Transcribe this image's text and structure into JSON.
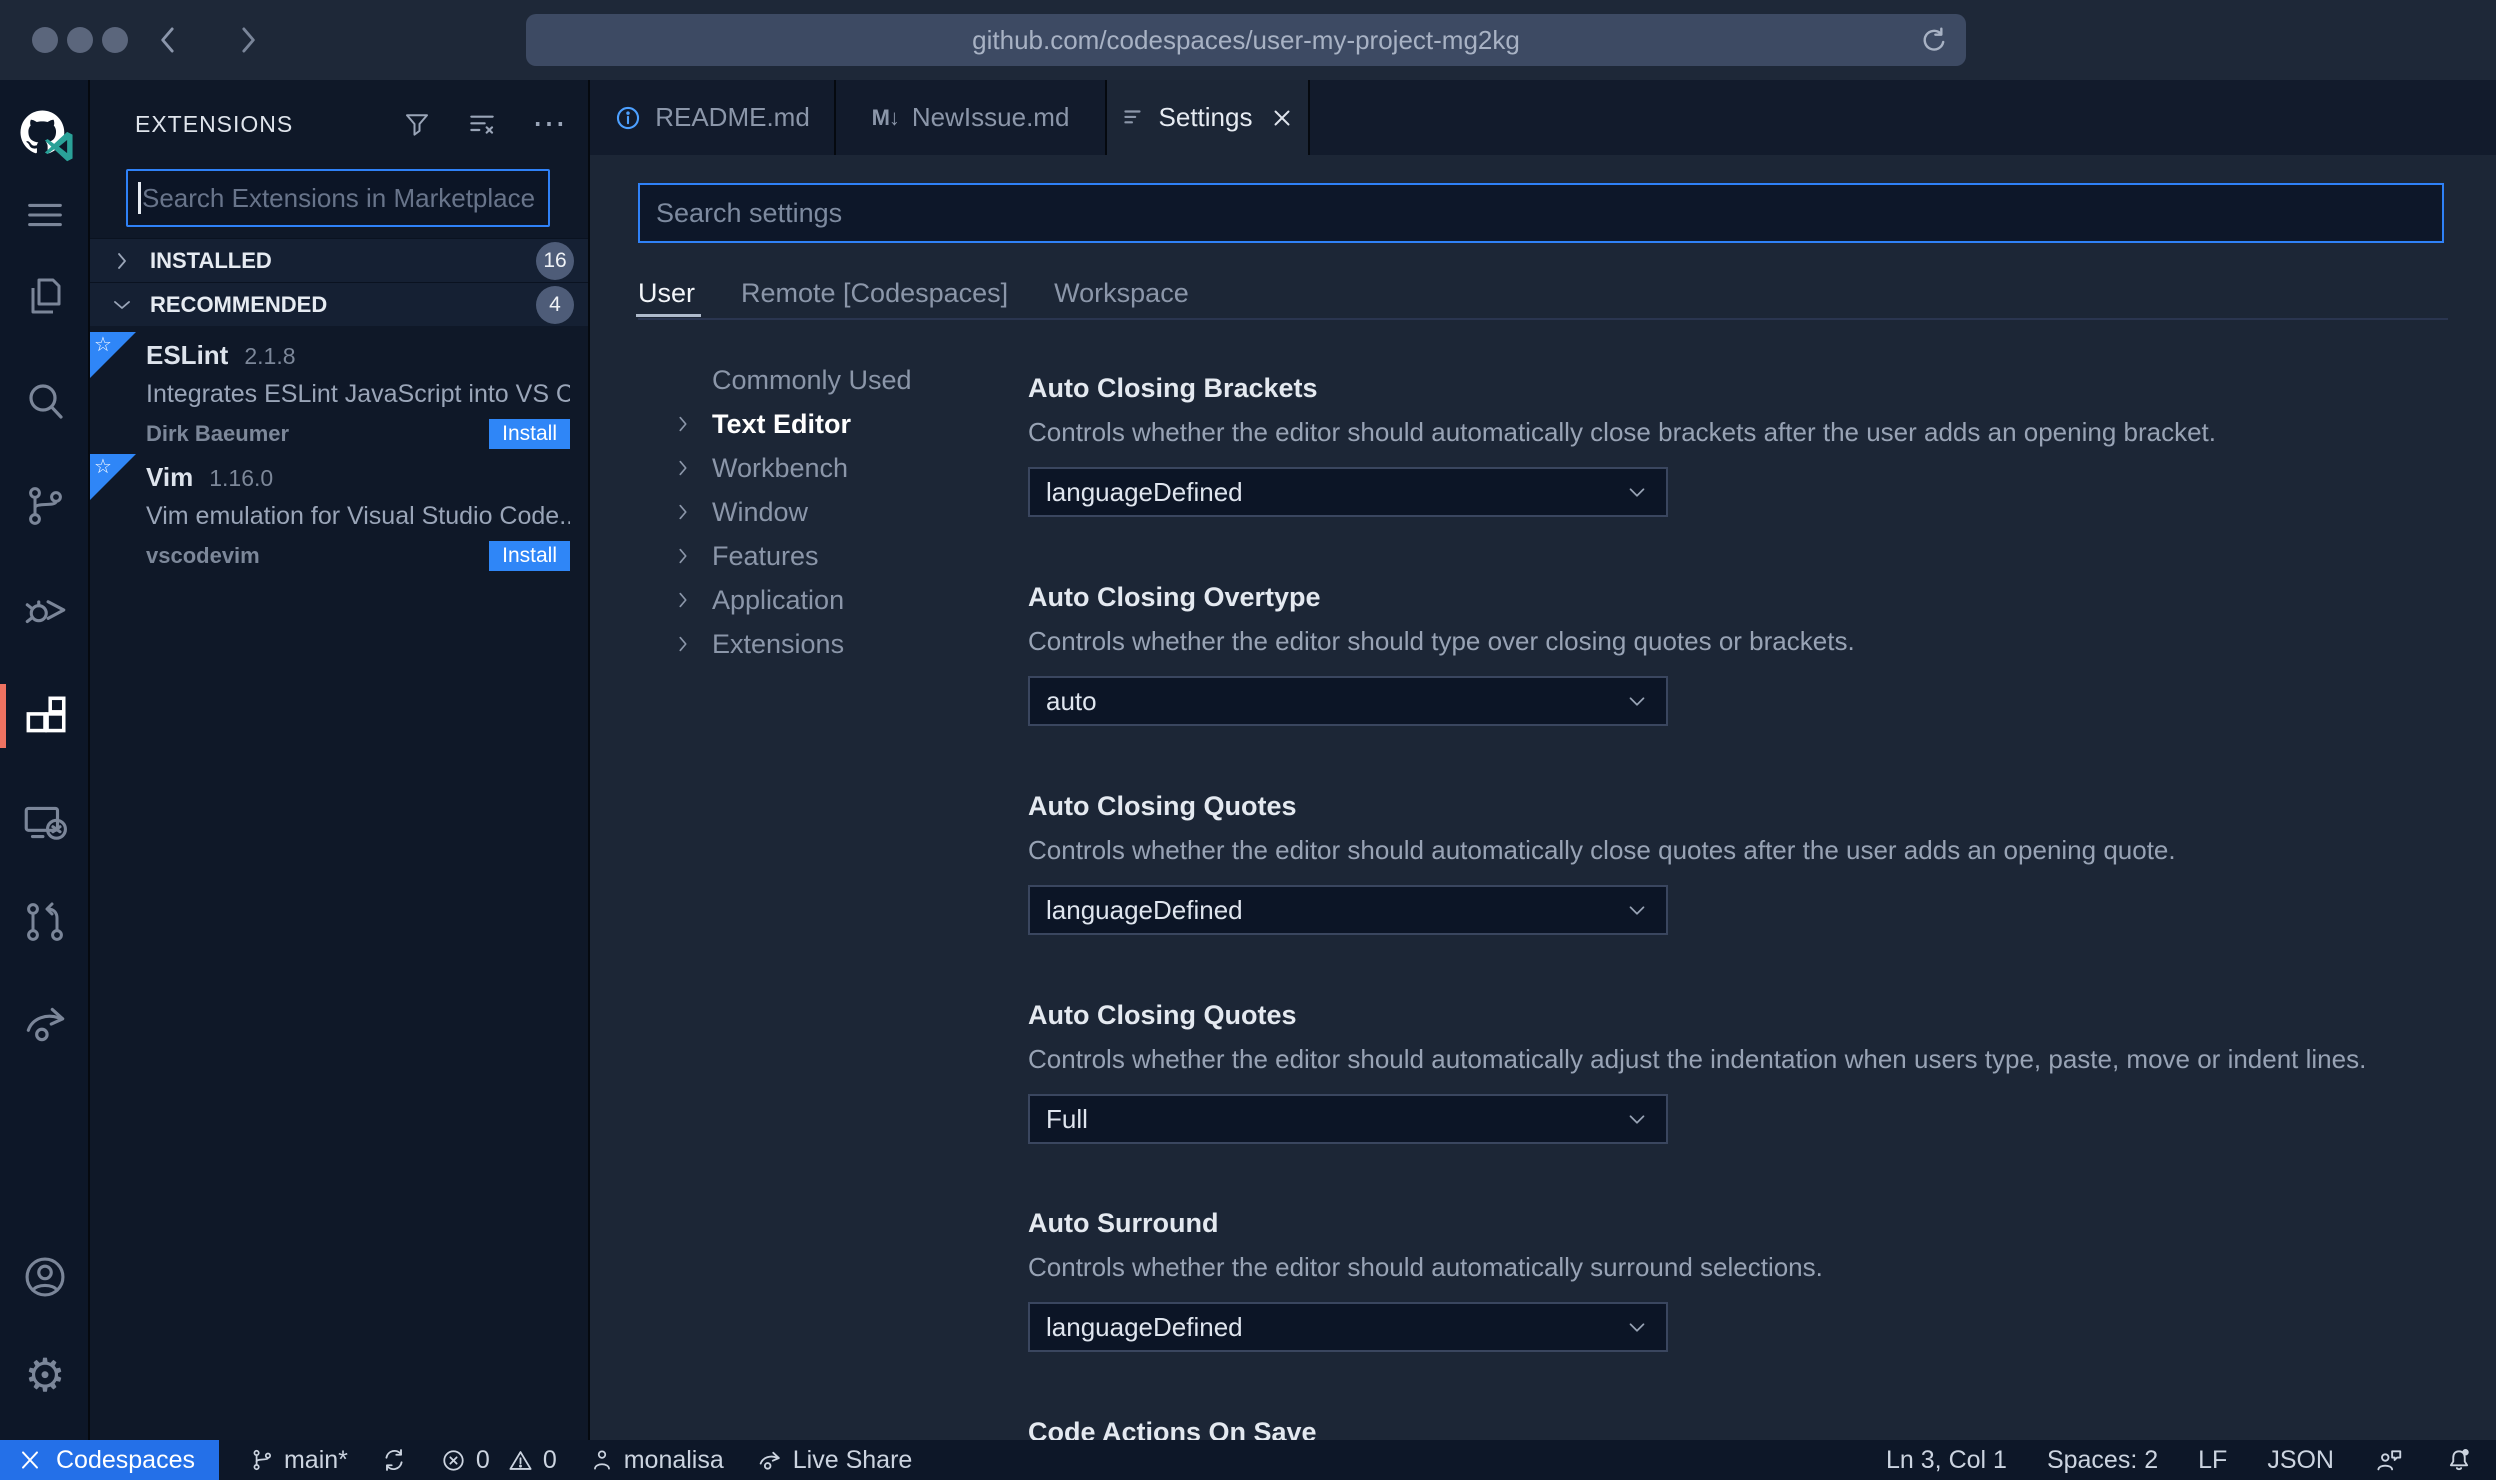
{
  "browser": {
    "url": "github.com/codespaces/user-my-project-mg2kg"
  },
  "sidebar": {
    "title": "EXTENSIONS",
    "search_placeholder": "Search Extensions in Marketplace",
    "sections": [
      {
        "label": "INSTALLED",
        "count": "16"
      },
      {
        "label": "RECOMMENDED",
        "count": "4"
      }
    ],
    "extensions": [
      {
        "name": "ESLint",
        "version": "2.1.8",
        "description": "Integrates ESLint JavaScript into VS C...",
        "publisher": "Dirk Baeumer",
        "action": "Install"
      },
      {
        "name": "Vim",
        "version": "1.16.0",
        "description": "Vim emulation for Visual Studio Code...",
        "publisher": "vscodevim",
        "action": "Install"
      }
    ]
  },
  "tabs": [
    {
      "label": "README.md"
    },
    {
      "label": "NewIssue.md"
    },
    {
      "label": "Settings"
    }
  ],
  "settings": {
    "search_placeholder": "Search settings",
    "scopes": [
      "User",
      "Remote [Codespaces]",
      "Workspace"
    ],
    "tree": [
      "Commonly Used",
      "Text Editor",
      "Workbench",
      "Window",
      "Features",
      "Application",
      "Extensions"
    ],
    "entries": [
      {
        "title": "Auto Closing Brackets",
        "description": "Controls whether the editor should automatically close brackets after the user adds an opening bracket.",
        "value": "languageDefined"
      },
      {
        "title": "Auto Closing Overtype",
        "description": "Controls whether the editor should type over closing quotes or brackets.",
        "value": "auto"
      },
      {
        "title": "Auto Closing Quotes",
        "description": "Controls whether the editor should automatically close quotes after the user adds an opening quote.",
        "value": "languageDefined"
      },
      {
        "title": "Auto Closing Quotes",
        "description": "Controls whether the editor should automatically adjust the indentation when users type, paste, move or indent lines.",
        "value": "Full"
      },
      {
        "title": "Auto Surround",
        "description": "Controls whether the editor should automatically surround selections.",
        "value": "languageDefined"
      },
      {
        "title": "Code Actions On Save",
        "description": "",
        "value": ""
      }
    ]
  },
  "status_bar": {
    "codespaces": "Codespaces",
    "branch": "main*",
    "errors": "0",
    "warnings": "0",
    "user": "monalisa",
    "live_share": "Live Share",
    "line_col": "Ln 3, Col 1",
    "spaces": "Spaces: 2",
    "eol": "LF",
    "language": "JSON"
  },
  "icons": {
    "ellipsis": "⋯",
    "markdown_tab": "M↓",
    "ribbon_star": "☆",
    "gear": "⚙"
  },
  "colors": {
    "accent_blue": "#2f81f7",
    "status_blue": "#2470e8",
    "active_indicator_orange": "#ee7261",
    "editor_bg": "#1c2636",
    "panel_bg": "#0f1828"
  }
}
